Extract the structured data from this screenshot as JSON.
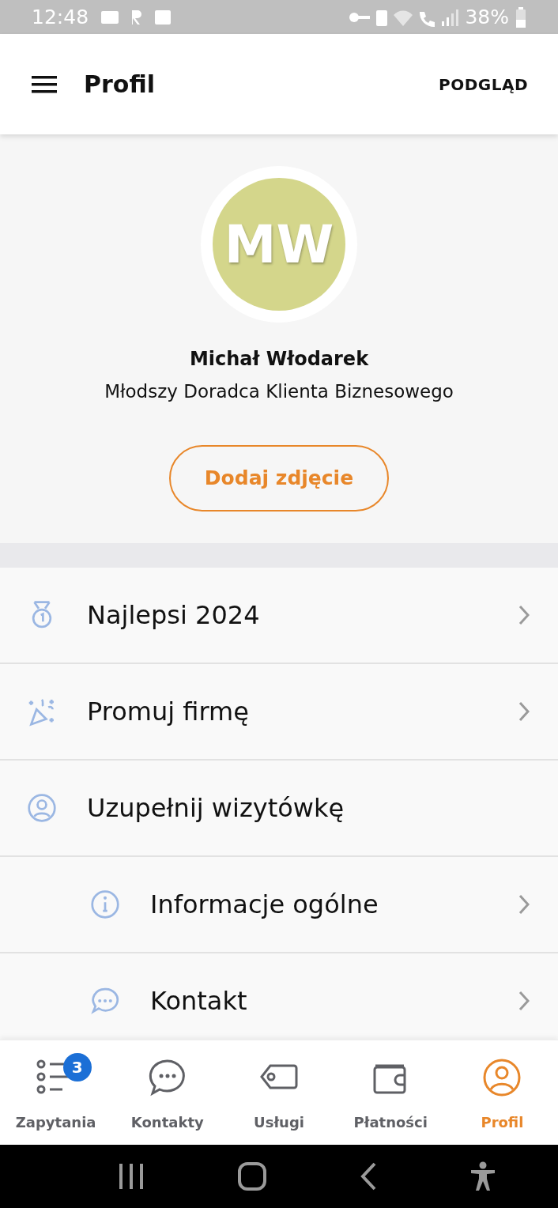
{
  "status_bar": {
    "time": "12:48",
    "battery": "38%"
  },
  "app_bar": {
    "title": "Profil",
    "action": "PODGLĄD"
  },
  "profile": {
    "initials": "MW",
    "name": "Michał Włodarek",
    "role": "Młodszy Doradca Klienta Biznesowego",
    "button": "Dodaj zdjęcie"
  },
  "menu": [
    {
      "label": "Najlepsi 2024",
      "chevron": true
    },
    {
      "label": "Promuj firmę",
      "chevron": true
    },
    {
      "label": "Uzupełnij wizytówkę",
      "chevron": false,
      "children": [
        {
          "label": "Informacje ogólne",
          "chevron": true
        },
        {
          "label": "Kontakt",
          "chevron": true
        }
      ]
    }
  ],
  "bottom_nav": [
    {
      "label": "Zapytania",
      "badge": "3",
      "selected": false
    },
    {
      "label": "Kontakty",
      "selected": false
    },
    {
      "label": "Usługi",
      "selected": false
    },
    {
      "label": "Płatności",
      "selected": false
    },
    {
      "label": "Profil",
      "selected": true
    }
  ]
}
